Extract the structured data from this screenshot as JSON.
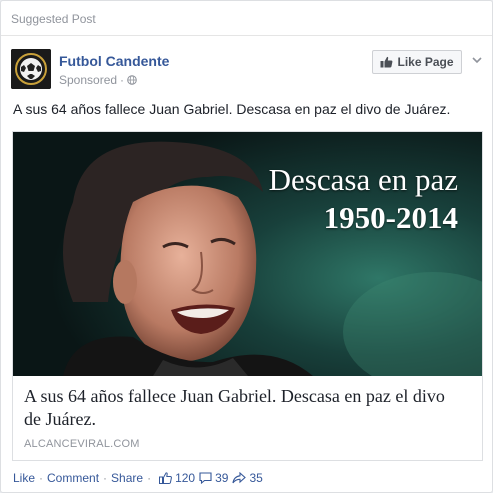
{
  "header": {
    "suggested_label": "Suggested Post"
  },
  "page": {
    "name": "Futbol Candente",
    "sponsored_label": "Sponsored",
    "dot": "·",
    "like_page_label": "Like Page",
    "avatar_icon": "soccer-ball-icon"
  },
  "post": {
    "text": "A sus 64 años fallece Juan Gabriel. Descasa en paz el divo de Juárez."
  },
  "link_preview": {
    "image_text_line1": "Descasa en paz",
    "image_text_line2": "1950-2014",
    "title": "A sus 64 años fallece Juan Gabriel. Descasa en paz el divo de Juárez.",
    "domain": "ALCANCEVIRAL.COM"
  },
  "actions": {
    "like": "Like",
    "comment": "Comment",
    "share": "Share",
    "dot": "·",
    "likes_count": "120",
    "comments_count": "39",
    "shares_count": "35"
  },
  "colors": {
    "link_blue": "#365899",
    "muted_gray": "#90949c",
    "border": "#dddfe2"
  }
}
